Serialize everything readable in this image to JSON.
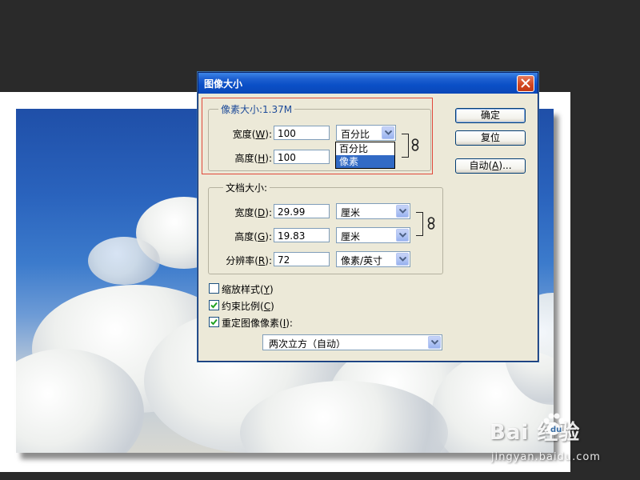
{
  "dialog": {
    "title": "图像大小",
    "pixel_dimensions": {
      "legend": "像素大小:1.37M",
      "width_label": "宽度(",
      "width_key": "W",
      "width_value": "100",
      "width_unit": "百分比",
      "height_label": "高度(",
      "height_key": "H",
      "height_value": "100",
      "unit_options": [
        "百分比",
        "像素"
      ],
      "selected_option": "像素"
    },
    "document_size": {
      "legend": "文档大小:",
      "width_label": "宽度(",
      "width_key": "D",
      "width_value": "29.99",
      "width_unit": "厘米",
      "height_label": "高度(",
      "height_key": "G",
      "height_value": "19.83",
      "height_unit": "厘米",
      "resolution_label": "分辨率(",
      "resolution_key": "R",
      "resolution_value": "72",
      "resolution_unit": "像素/英寸"
    },
    "label_close": "):",
    "options": {
      "scale_styles_label": "缩放样式(",
      "scale_styles_key": "Y",
      "scale_styles_checked": false,
      "constrain_label": "约束比例(",
      "constrain_key": "C",
      "constrain_checked": true,
      "resample_label": "重定图像像素(",
      "resample_key": "I",
      "resample_checked": true,
      "paren_close": ")",
      "label_colon": "):",
      "resample_method": "两次立方（自动）"
    },
    "buttons": {
      "ok": "确定",
      "reset": "复位",
      "auto_prefix": "自动(",
      "auto_key": "A",
      "auto_suffix": ")..."
    }
  },
  "watermark": {
    "logo_text": "Bai  经验",
    "url": "jingyan.baidu.com"
  }
}
